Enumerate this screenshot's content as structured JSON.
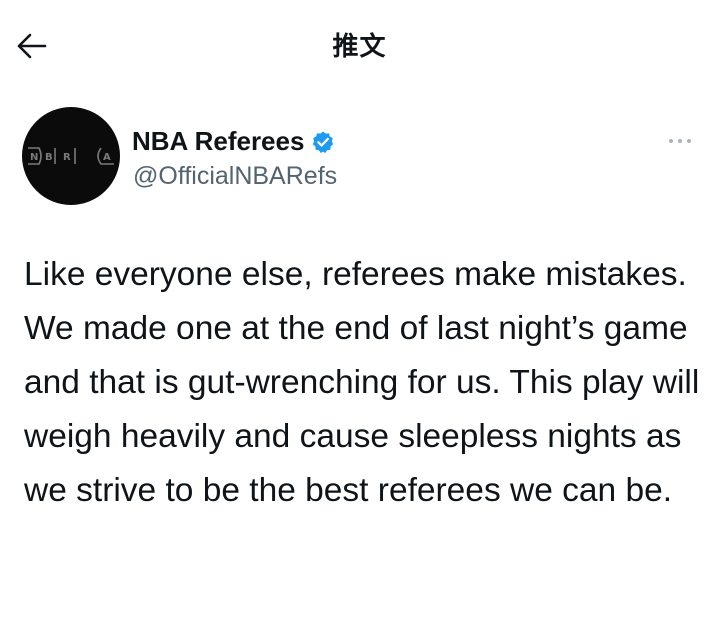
{
  "header": {
    "title": "推文",
    "back_icon": "arrow-left-icon"
  },
  "author": {
    "display_name": "NBA Referees",
    "handle": "@OfficialNBARefs",
    "verified": true,
    "verified_color": "#1d9bf0",
    "avatar_logo_text": "NBRA"
  },
  "more_icon": "more-horizontal-icon",
  "tweet": {
    "text": "Like everyone else, referees make mistakes. We made one at the end of last night’s game and that is gut-wrenching for us. This play will weigh heavily and cause sleepless nights as we strive to be the best referees we can be."
  }
}
